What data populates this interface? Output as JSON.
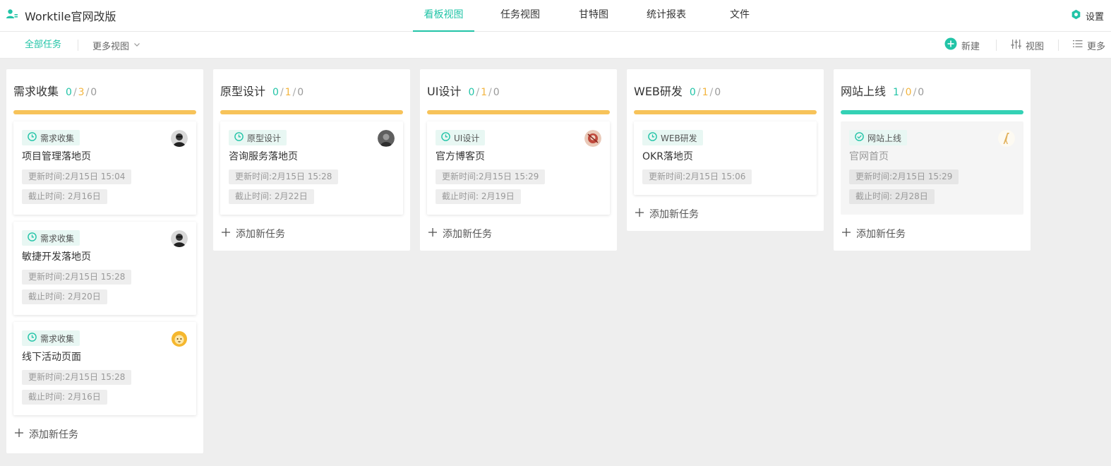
{
  "project": {
    "title": "Worktile官网改版",
    "icon": "project-user-icon"
  },
  "nav": {
    "tabs": [
      {
        "label": "看板视图",
        "active": true
      },
      {
        "label": "任务视图",
        "active": false
      },
      {
        "label": "甘特图",
        "active": false
      },
      {
        "label": "统计报表",
        "active": false
      },
      {
        "label": "文件",
        "active": false
      }
    ],
    "settings_label": "设置"
  },
  "subbar": {
    "all_tasks": "全部任务",
    "more_views": "更多视图",
    "new_label": "新建",
    "view_label": "视图",
    "more_label": "更多"
  },
  "colors": {
    "accent": "#22c4a7",
    "in_progress": "#f7c35a",
    "done_bar": "#34d1b5",
    "count_doing": "#f3b53f"
  },
  "columns": [
    {
      "name": "需求收集",
      "done": "0",
      "doing": "3",
      "todo": "0",
      "status": "in_progress",
      "add_label": "添加新任务",
      "cards": [
        {
          "tag": "需求收集",
          "title": "项目管理落地页",
          "updated": "更新时间:2月15日 15:04",
          "deadline": "截止时间: 2月16日",
          "avatar": "avatar-man-bw"
        },
        {
          "tag": "需求收集",
          "title": "敏捷开发落地页",
          "updated": "更新时间:2月15日 15:28",
          "deadline": "截止时间: 2月20日",
          "avatar": "avatar-man-bw"
        },
        {
          "tag": "需求收集",
          "title": "线下活动页面",
          "updated": "更新时间:2月15日 15:28",
          "deadline": "截止时间: 2月16日",
          "avatar": "avatar-lion"
        }
      ]
    },
    {
      "name": "原型设计",
      "done": "0",
      "doing": "1",
      "todo": "0",
      "status": "in_progress",
      "add_label": "添加新任务",
      "cards": [
        {
          "tag": "原型设计",
          "title": "咨询服务落地页",
          "updated": "更新时间:2月15日 15:28",
          "deadline": "截止时间: 2月22日",
          "avatar": "avatar-dark"
        }
      ]
    },
    {
      "name": "UI设计",
      "done": "0",
      "doing": "1",
      "todo": "0",
      "status": "in_progress",
      "add_label": "添加新任务",
      "cards": [
        {
          "tag": "UI设计",
          "title": "官方博客页",
          "updated": "更新时间:2月15日 15:29",
          "deadline": "截止时间: 2月19日",
          "avatar": "avatar-red"
        }
      ]
    },
    {
      "name": "WEB研发",
      "done": "0",
      "doing": "1",
      "todo": "0",
      "status": "in_progress",
      "add_label": "添加新任务",
      "cards": [
        {
          "tag": "WEB研发",
          "title": "OKR落地页",
          "updated": "更新时间:2月15日 15:06",
          "deadline": "",
          "avatar": ""
        }
      ]
    },
    {
      "name": "网站上线",
      "done": "1",
      "doing": "0",
      "todo": "0",
      "status": "done",
      "add_label": "添加新任务",
      "cards": [
        {
          "tag": "网站上线",
          "title": "官网首页",
          "updated": "更新时间:2月15日 15:29",
          "deadline": "截止时间: 2月28日",
          "avatar": "avatar-giraffe",
          "done": true
        }
      ]
    }
  ]
}
